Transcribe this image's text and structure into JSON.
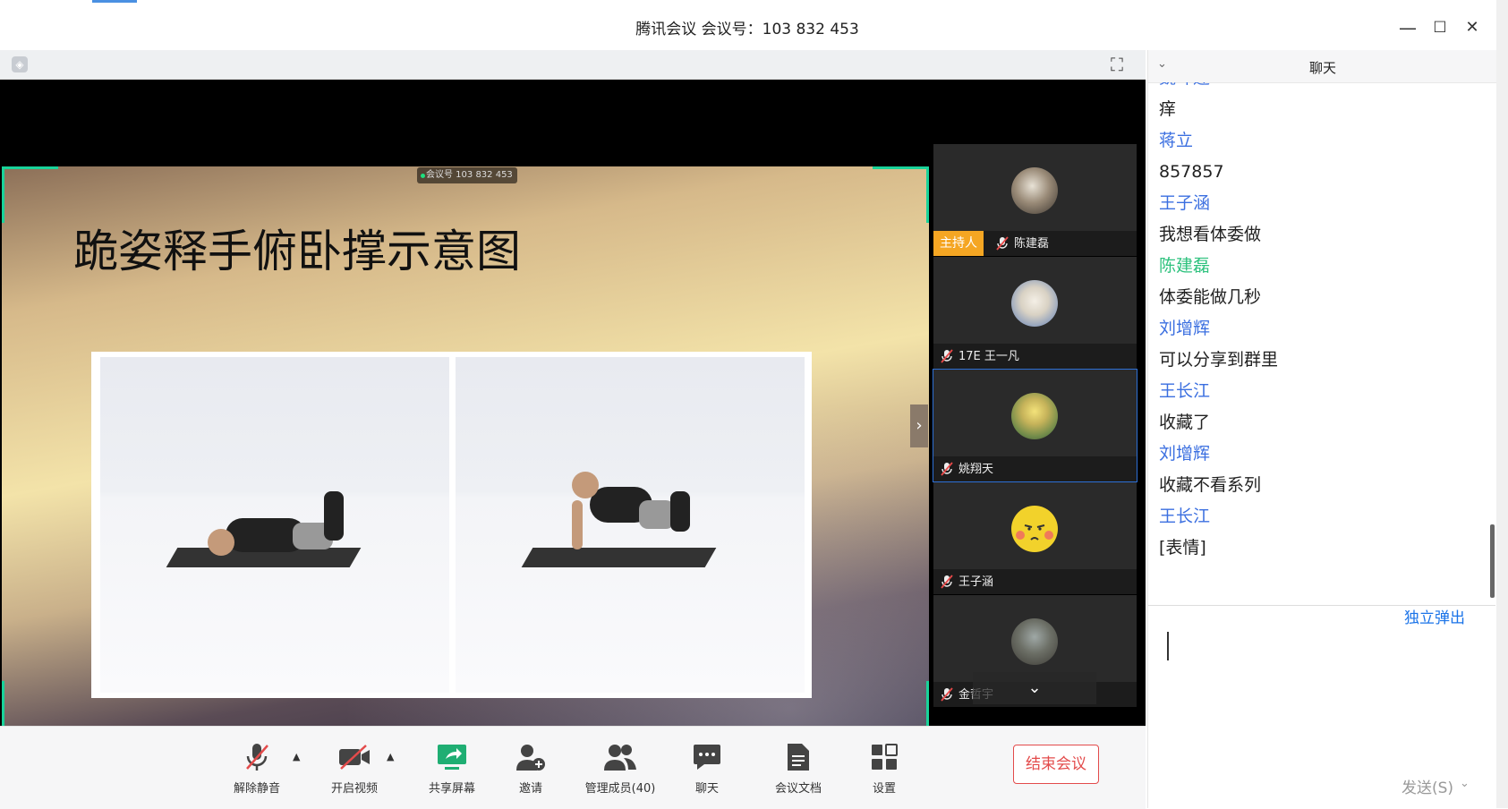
{
  "window": {
    "title": "腾讯会议 会议号：103 832 453",
    "minimize_icon": "—",
    "maximize_icon": "☐",
    "close_icon": "✕"
  },
  "stage": {
    "meeting_tag": "会议号 103 832 453",
    "slide_title": "跪姿释手俯卧撑示意图"
  },
  "gallery": {
    "host_badge": "主持人",
    "participants": [
      {
        "name": "陈建磊"
      },
      {
        "name": "17E 王一凡"
      },
      {
        "name": "姚翔天"
      },
      {
        "name": "王子涵"
      },
      {
        "name": "金哲宇"
      }
    ]
  },
  "toolbar": {
    "mute": "解除静音",
    "video": "开启视频",
    "share": "共享屏幕",
    "invite": "邀请",
    "members": "管理成员(40)",
    "chat": "聊天",
    "docs": "会议文档",
    "settings": "设置",
    "end": "结束会议"
  },
  "chat": {
    "title": "聊天",
    "messages": [
      {
        "sender": "魏坤莲",
        "text": "痒"
      },
      {
        "sender": "蒋立",
        "text": "857857"
      },
      {
        "sender": "王子涵",
        "text": "我想看体委做"
      },
      {
        "sender": "陈建磊",
        "text": "体委能做几秒"
      },
      {
        "sender": "刘增辉",
        "text": "可以分享到群里"
      },
      {
        "sender": "王长江",
        "text": "收藏了"
      },
      {
        "sender": "刘增辉",
        "text": "收藏不看系列"
      },
      {
        "sender": "王长江",
        "text": "[表情]"
      }
    ],
    "popout": "独立弹出",
    "send": "发送(S)"
  },
  "colors": {
    "accent_green": "#19d39a",
    "sender_blue": "#3b6fe0",
    "host_sender_green": "#2ec27e",
    "host_orange": "#f5a623",
    "end_red": "#e34b4b",
    "link_blue": "#1a73e8"
  }
}
